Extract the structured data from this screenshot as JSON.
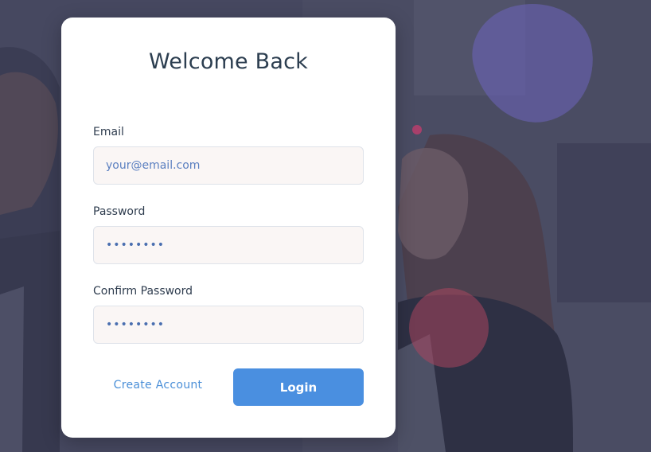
{
  "form": {
    "title": "Welcome Back",
    "email": {
      "label": "Email",
      "placeholder": "your@email.com",
      "value": ""
    },
    "password": {
      "label": "Password",
      "value": "••••••••"
    },
    "confirm_password": {
      "label": "Confirm Password",
      "value": "••••••••"
    },
    "create_account_label": "Create Account",
    "login_label": "Login"
  },
  "colors": {
    "accent": "#4a8fe0",
    "link": "#4a8fd8",
    "title": "#2c3e50",
    "field_bg": "#faf6f5"
  }
}
